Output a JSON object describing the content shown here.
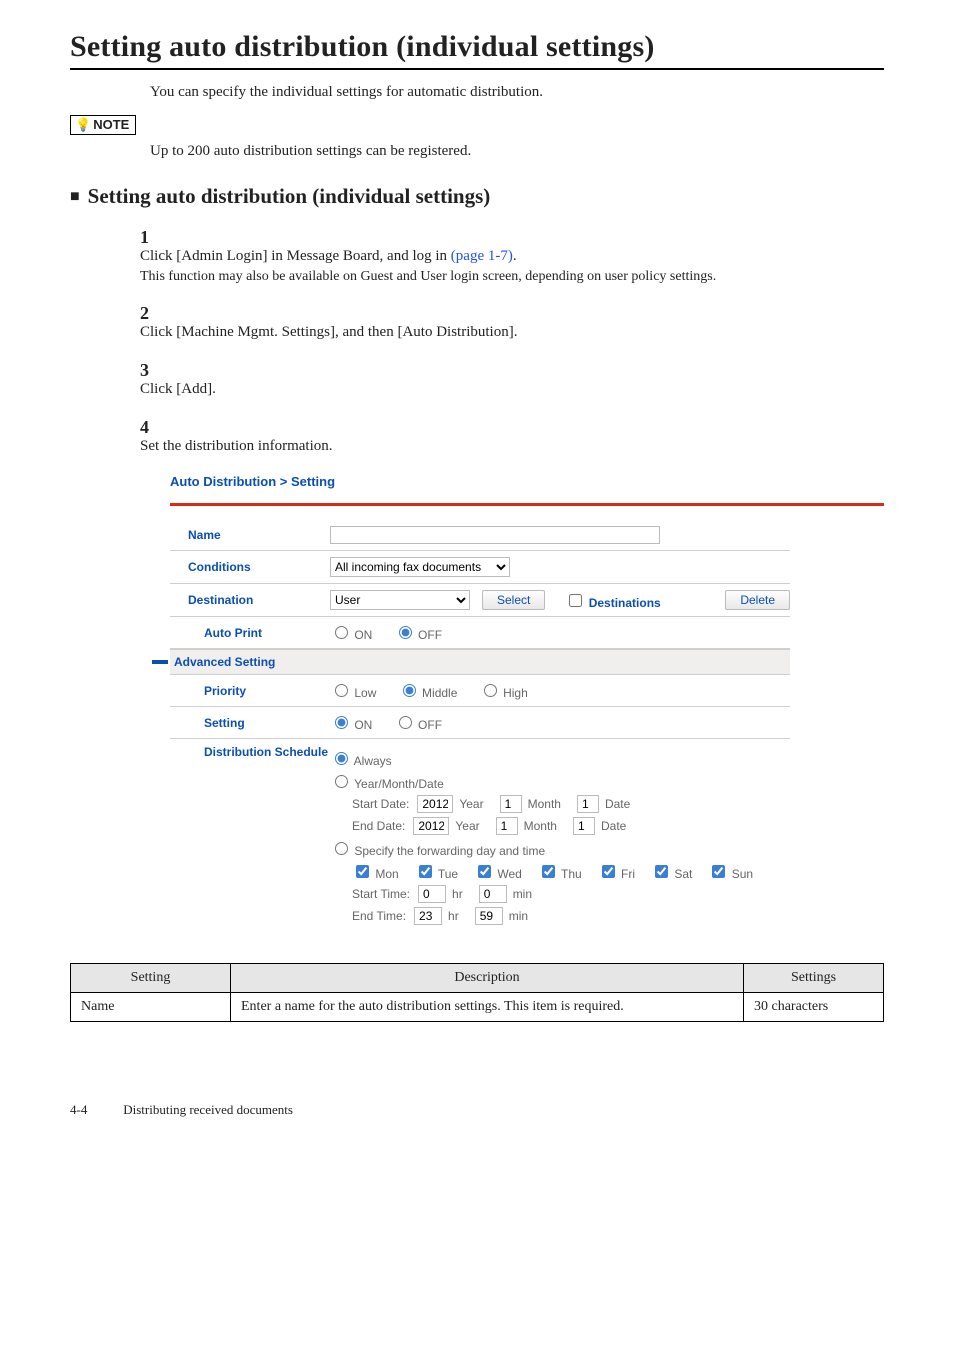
{
  "page": {
    "title": "Setting auto distribution (individual settings)",
    "intro": "You can specify the individual settings for automatic distribution.",
    "note_label": "NOTE",
    "note_body": "Up to 200 auto distribution settings can be registered.",
    "sub_title": "Setting auto distribution (individual settings)"
  },
  "steps": {
    "s1": {
      "num": "1",
      "text_a": "Click [Admin Login] in Message Board, and log in ",
      "link": "(page 1-7)",
      "text_b": ".",
      "sub": "This function may also be available on Guest and User login screen, depending on user policy settings."
    },
    "s2": {
      "num": "2",
      "text": "Click [Machine Mgmt. Settings], and then [Auto Distribution]."
    },
    "s3": {
      "num": "3",
      "text": "Click [Add]."
    },
    "s4": {
      "num": "4",
      "text": "Set the distribution information."
    }
  },
  "form": {
    "breadcrumb": "Auto Distribution > Setting",
    "labels": {
      "name": "Name",
      "conditions": "Conditions",
      "destination": "Destination",
      "auto_print": "Auto Print",
      "advanced": "Advanced Setting",
      "priority": "Priority",
      "setting": "Setting",
      "schedule": "Distribution Schedule"
    },
    "conditions_select": "All incoming fax documents",
    "destination": {
      "select": "User",
      "btn_select": "Select",
      "cb_destinations": "Destinations",
      "btn_delete": "Delete"
    },
    "onoff": {
      "on": "ON",
      "off": "OFF"
    },
    "priority": {
      "low": "Low",
      "middle": "Middle",
      "high": "High"
    },
    "schedule": {
      "always": "Always",
      "ymd": "Year/Month/Date",
      "start_date_lbl": "Start Date:",
      "end_date_lbl": "End Date:",
      "start_year": "2012",
      "start_year_unit": "Year",
      "start_month": "1",
      "start_month_unit": "Month",
      "start_day": "1",
      "start_day_unit": "Date",
      "end_year": "2012",
      "end_year_unit": "Year",
      "end_month": "1",
      "end_month_unit": "Month",
      "end_day": "1",
      "end_day_unit": "Date",
      "specify": "Specify the forwarding day and time",
      "mon": "Mon",
      "tue": "Tue",
      "wed": "Wed",
      "thu": "Thu",
      "fri": "Fri",
      "sat": "Sat",
      "sun": "Sun",
      "start_time_lbl": "Start Time:",
      "start_hr": "0",
      "start_min": "0",
      "end_time_lbl": "End Time:",
      "end_hr": "23",
      "end_min": "59",
      "hr_unit": "hr",
      "min_unit": "min"
    }
  },
  "table": {
    "h_setting": "Setting",
    "h_desc": "Description",
    "h_limits": "Settings",
    "row1_setting": "Name",
    "row1_desc": "Enter a name for the auto distribution settings. This item is required.",
    "row1_limits": "30 characters"
  },
  "footer": {
    "page_num": "4-4",
    "chapter": "Distributing received documents"
  }
}
